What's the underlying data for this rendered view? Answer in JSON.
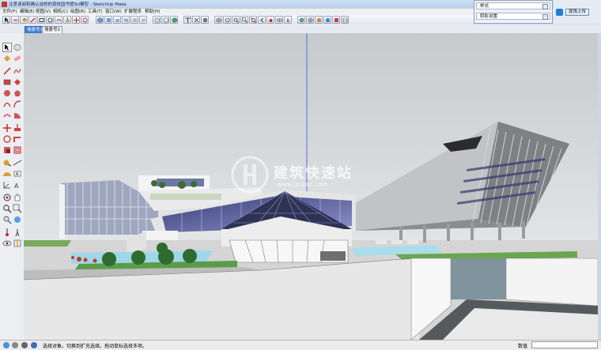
{
  "window": {
    "title": "注意请阅和确认选修的现校园书馆SU模型 - SketchUp Make"
  },
  "menu": [
    {
      "label": "文件(F)"
    },
    {
      "label": "编辑(E)"
    },
    {
      "label": "视图(V)"
    },
    {
      "label": "相机(C)"
    },
    {
      "label": "绘图(R)"
    },
    {
      "label": "工具(T)"
    },
    {
      "label": "窗口(W)"
    },
    {
      "label": "扩展程序"
    },
    {
      "label": "帮助(H)"
    }
  ],
  "right_panel": {
    "style_label": "样式",
    "shadow_label": "阴影设置"
  },
  "login": {
    "button_label": "现场上传"
  },
  "scenes": {
    "tabs": [
      {
        "label": "场景号1"
      },
      {
        "label": "场景号2"
      }
    ]
  },
  "watermark": {
    "text": "建筑快速站",
    "sub": "www.jzcom.com"
  },
  "status": {
    "message": "选择对象。切换到扩充选择。拖动鼠标选择多项。",
    "measure_label": "数值"
  },
  "colors": {
    "sky_top": "#c9ccd0",
    "sky_bottom": "#eef0f1",
    "ground": "#cfcfcf",
    "accent": "#3d7dd6"
  }
}
